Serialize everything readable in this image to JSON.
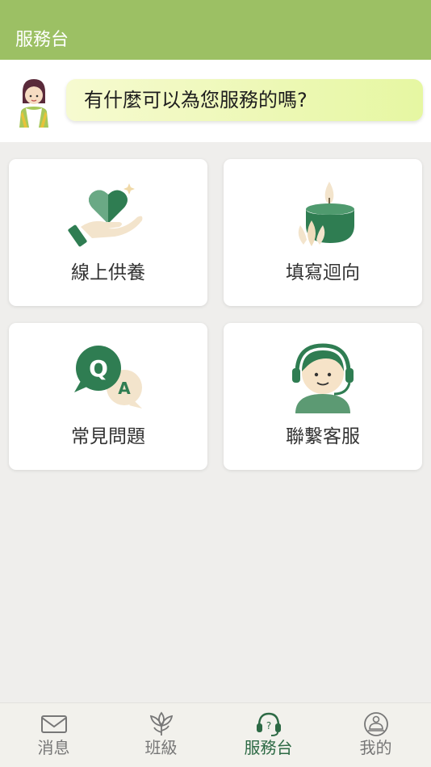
{
  "header": {
    "title": "服務台"
  },
  "greeting": {
    "text": "有什麼可以為您服務的嗎?",
    "avatar_icon": "service-girl-avatar"
  },
  "cards": [
    {
      "label": "線上供養",
      "icon": "heart-hand-icon"
    },
    {
      "label": "填寫迴向",
      "icon": "candle-lotus-icon"
    },
    {
      "label": "常見問題",
      "icon": "qa-bubble-icon"
    },
    {
      "label": "聯繫客服",
      "icon": "headset-agent-icon"
    }
  ],
  "tabbar": {
    "items": [
      {
        "label": "消息",
        "icon": "envelope-icon",
        "active": false
      },
      {
        "label": "班級",
        "icon": "lotus-icon",
        "active": false
      },
      {
        "label": "服務台",
        "icon": "headset-help-icon",
        "active": true
      },
      {
        "label": "我的",
        "icon": "meditation-person-icon",
        "active": false
      }
    ]
  },
  "colors": {
    "header": "#9cc064",
    "accent": "#2d6a45",
    "bubble": "#e6f7a2"
  }
}
